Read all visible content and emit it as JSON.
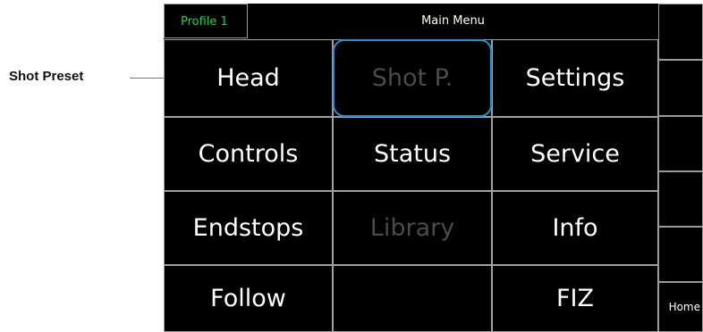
{
  "annotation": {
    "label": "Shot Preset"
  },
  "header": {
    "profile": "Profile 1",
    "title": "Main Menu"
  },
  "menu": [
    {
      "label": "Head",
      "enabled": true
    },
    {
      "label": "Shot P.",
      "enabled": false
    },
    {
      "label": "Settings",
      "enabled": true
    },
    {
      "label": "Controls",
      "enabled": true
    },
    {
      "label": "Status",
      "enabled": true
    },
    {
      "label": "Service",
      "enabled": true
    },
    {
      "label": "Endstops",
      "enabled": true
    },
    {
      "label": "Library",
      "enabled": false
    },
    {
      "label": "Info",
      "enabled": true
    },
    {
      "label": "Follow",
      "enabled": true
    },
    {
      "label": "",
      "enabled": false
    },
    {
      "label": "FIZ",
      "enabled": true
    }
  ],
  "side_buttons": [
    "",
    "",
    "",
    "",
    "",
    "Home"
  ],
  "colors": {
    "highlight": "#1e90d6",
    "profile_text": "#22d34a",
    "disabled_text": "#4a4a4a"
  }
}
